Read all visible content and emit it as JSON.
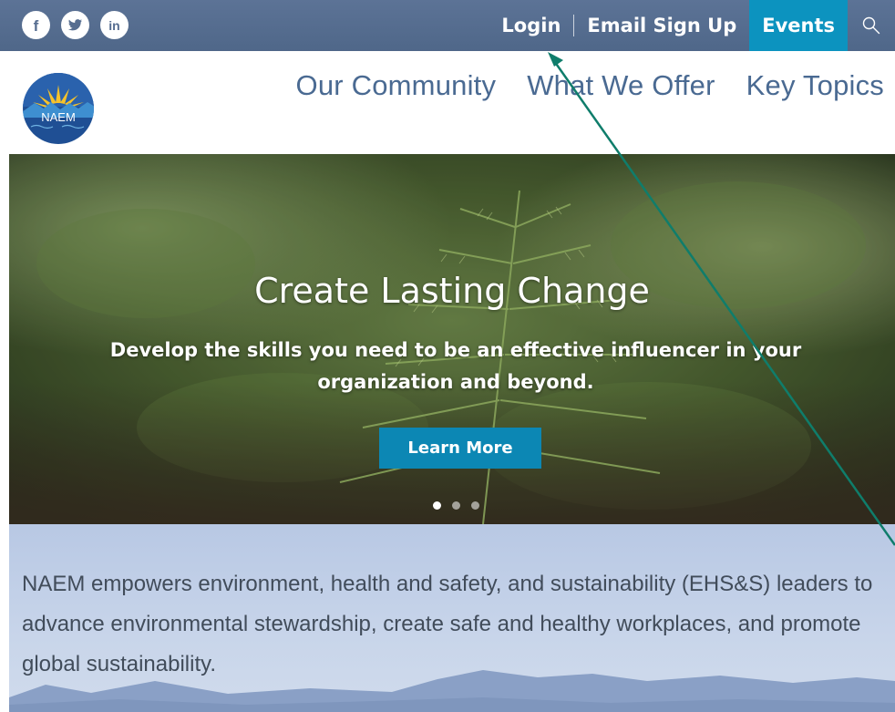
{
  "topbar": {
    "social": [
      {
        "icon": "facebook-icon",
        "glyph": "f"
      },
      {
        "icon": "twitter-icon",
        "glyph": "t"
      },
      {
        "icon": "linkedin-icon",
        "glyph": "in"
      }
    ],
    "login_label": "Login",
    "email_signup_label": "Email Sign Up",
    "events_label": "Events",
    "search_icon": "search-icon",
    "bar_color": "#566d90",
    "events_color": "#0c93bf"
  },
  "logo": {
    "text": "NAEM"
  },
  "nav": {
    "items": [
      {
        "label": "Our Community"
      },
      {
        "label": "What We Offer"
      },
      {
        "label": "Key Topics"
      }
    ],
    "color": "#4a6a92"
  },
  "hero": {
    "title": "Create Lasting Change",
    "subtitle": "Develop the skills you need to be an effective influencer in your organization and beyond.",
    "button_label": "Learn More",
    "button_color": "#0c87b4",
    "slide_count": 3,
    "active_slide": 1
  },
  "mission": {
    "text": "NAEM empowers environment, health and safety, and sustainability (EHS&S) leaders to advance environmental stewardship, create safe and healthy workplaces, and promote global sustainability."
  },
  "annotation": {
    "arrow_color": "#0f7d6b"
  }
}
